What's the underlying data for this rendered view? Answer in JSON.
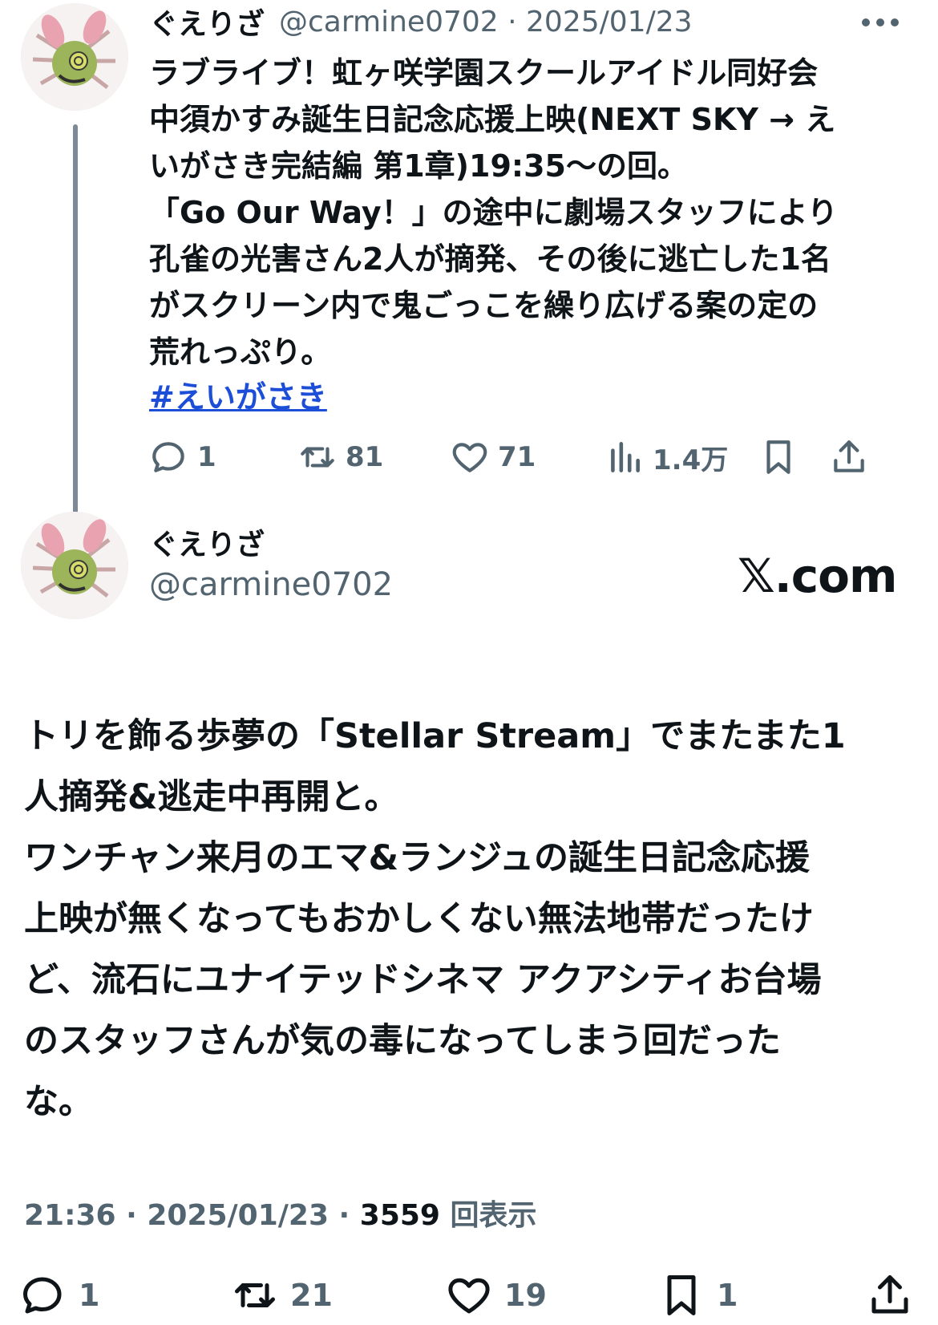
{
  "tweet1": {
    "display_name": "ぐえりざ",
    "handle_date": "@carmine0702 · 2025/01/23",
    "more_icon": "more-horizontal-icon",
    "text": "ラブライブ！虹ヶ咲学園スクールアイドル同好会\n中須かすみ誕生日記念応援上映(NEXT SKY → え\nいがさき完結編 第1章)19:35〜の回。\n「Go Our Way！」の途中に劇場スタッフにより\n孔雀の光害さん2人が摘発、その後に逃亡した1名\nがスクリーン内で鬼ごっこを繰り広げる案の定の\n荒れっぷり。",
    "hashtag": "#えいがさき",
    "replies": "1",
    "retweets": "81",
    "likes": "71",
    "views": "1.4万"
  },
  "tweet2": {
    "display_name": "ぐえりざ",
    "handle": "@carmine0702",
    "brand": "𝕏.com",
    "text": "トリを飾る歩夢の「Stellar Stream」でまたまた1\n人摘発&逃走中再開と。\nワンチャン来月のエマ&ランジュの誕生日記念応援\n上映が無くなってもおかしくない無法地帯だったけ\nど、流石にユナイテッドシネマ アクアシティお台場\nのスタッフさんが気の毒になってしまう回だった\nな。",
    "time_date": "21:36 · 2025/01/23 · ",
    "views_count": "3559",
    "views_label": " 回表示",
    "replies": "1",
    "retweets": "21",
    "likes": "19",
    "bookmarks": "1"
  },
  "colors": {
    "text": "#0f1419",
    "muted": "#536471",
    "link": "#1d4ed8",
    "thread_line": "#7b8a96"
  }
}
